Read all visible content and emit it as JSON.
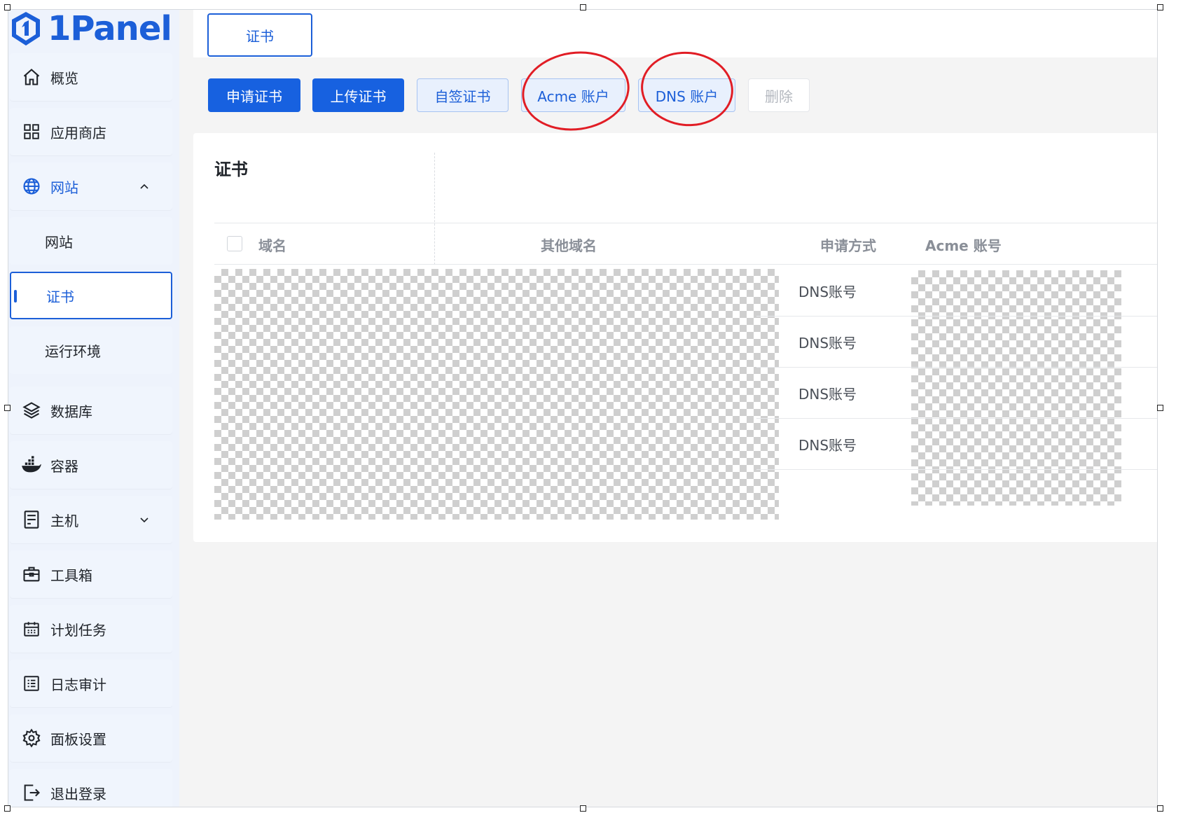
{
  "brand": {
    "logo_text": "1Panel"
  },
  "sidebar": {
    "items": [
      {
        "label": "概览",
        "icon": "home-icon"
      },
      {
        "label": "应用商店",
        "icon": "grid-icon"
      },
      {
        "label": "网站",
        "icon": "globe-icon",
        "expanded": true
      },
      {
        "label": "数据库",
        "icon": "layers-icon"
      },
      {
        "label": "容器",
        "icon": "docker-icon"
      },
      {
        "label": "主机",
        "icon": "server-icon",
        "expanded": false
      },
      {
        "label": "工具箱",
        "icon": "toolbox-icon"
      },
      {
        "label": "计划任务",
        "icon": "calendar-icon"
      },
      {
        "label": "日志审计",
        "icon": "list-icon"
      },
      {
        "label": "面板设置",
        "icon": "gear-icon"
      },
      {
        "label": "退出登录",
        "icon": "logout-icon"
      }
    ],
    "submenu": [
      {
        "label": "网站"
      },
      {
        "label": "证书",
        "selected": true
      },
      {
        "label": "运行环境"
      }
    ]
  },
  "tabs": {
    "active": "证书"
  },
  "toolbar": {
    "apply_cert": "申请证书",
    "upload_cert": "上传证书",
    "self_signed": "自签证书",
    "acme_account": "Acme 账户",
    "dns_account": "DNS 账户",
    "delete": "删除"
  },
  "card": {
    "title": "证书",
    "columns": [
      "域名",
      "其他域名",
      "申请方式",
      "Acme 账号"
    ],
    "rows": [
      {
        "method": "DNS账号"
      },
      {
        "method": "DNS账号"
      },
      {
        "method": "DNS账号"
      },
      {
        "method": "DNS账号"
      }
    ]
  },
  "colors": {
    "primary": "#1761e0",
    "annotation": "#e11d25",
    "sidebar_bg": "#eef3fc"
  }
}
